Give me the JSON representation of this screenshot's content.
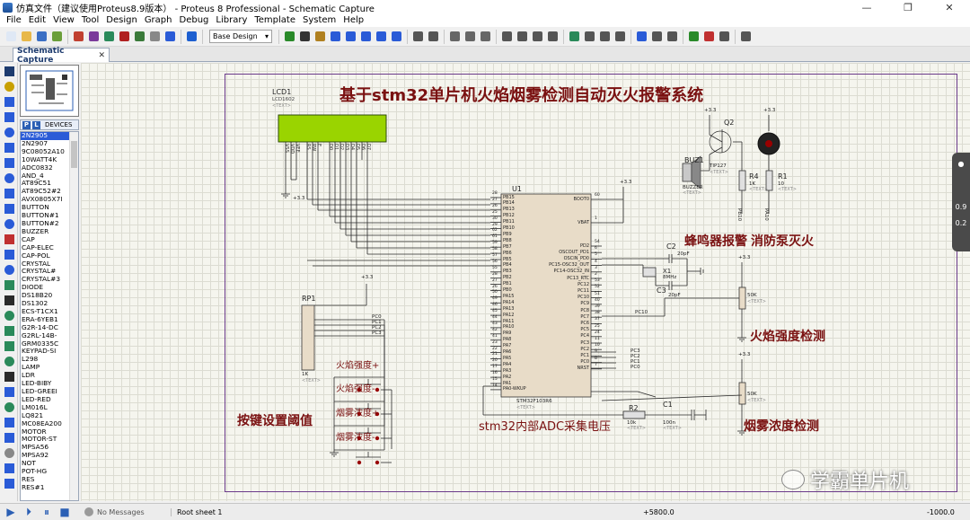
{
  "window": {
    "title": "仿真文件（建议使用Proteus8.9版本） - Proteus 8 Professional - Schematic Capture",
    "minimize": "—",
    "maximize": "❐",
    "close": "✕"
  },
  "menu": [
    "File",
    "Edit",
    "View",
    "Tool",
    "Design",
    "Graph",
    "Debug",
    "Library",
    "Template",
    "System",
    "Help"
  ],
  "toolbar": {
    "design_select": "Base Design"
  },
  "tabs": [
    {
      "label": "Schematic Capture",
      "close": "✕"
    }
  ],
  "devices": {
    "tabs": [
      "P",
      "L"
    ],
    "header": "DEVICES",
    "items": [
      "2N2905",
      "2N2907",
      "9C08052A10",
      "10WATT4K",
      "ADC0832",
      "AND_4",
      "AT89C51",
      "AT89C52#2",
      "AVX0805X7I",
      "BUTTON",
      "BUTTON#1",
      "BUTTON#2",
      "BUZZER",
      "CAP",
      "CAP-ELEC",
      "CAP-POL",
      "CRYSTAL",
      "CRYSTAL#",
      "CRYSTAL#3",
      "DIODE",
      "DS18B20",
      "DS1302",
      "ECS-T1CX1",
      "ERA-6YEB1",
      "G2R-14-DC",
      "G2RL-14B-",
      "GRM0335C",
      "KEYPAD-SI",
      "L298",
      "LAMP",
      "LDR",
      "LED-BIBY",
      "LED-GREEI",
      "LED-RED",
      "LM016L",
      "LQ821",
      "MC08EA200",
      "MOTOR",
      "MOTOR-ST",
      "MPSA56",
      "MPSA92",
      "NOT",
      "POT-HG",
      "RES",
      "RES#1"
    ],
    "selected_index": 0
  },
  "schematic": {
    "title": "基于stm32单片机火焰烟雾检测自动灭火报警系统",
    "labels": {
      "buzzer_alarm": "蜂鸣器报警",
      "pump": "消防泵灭火",
      "flame": "火焰强度检测",
      "smoke": "烟雾浓度检测",
      "keys": "按键设置阈值",
      "adc": "stm32内部ADC采集电压",
      "flame_up": "火焰强度+",
      "flame_dn": "火焰强度-",
      "smoke_up": "烟雾浓度+",
      "smoke_dn": "烟雾浓度-"
    },
    "lcd": {
      "ref": "LCD1",
      "part": "LCD1602",
      "text": "<TEXT>",
      "pins": [
        "VSS",
        "VDD",
        "VEE",
        "RS",
        "RW",
        "E",
        "D0",
        "D1",
        "D2",
        "D3",
        "D4",
        "D5",
        "D6",
        "D7"
      ]
    },
    "mcu": {
      "ref": "U1",
      "part": "STM32F103R6",
      "text": "<TEXT>",
      "left_pins": [
        "PB15",
        "PB14",
        "PB13",
        "PB12",
        "PB11",
        "PB10",
        "PB9",
        "PB8",
        "PB7",
        "PB6",
        "PB5",
        "PB4",
        "PB3",
        "PB2",
        "PB1",
        "PB0",
        "PA15",
        "PA14",
        "PA13",
        "PA12",
        "PA11",
        "PA10",
        "PA9",
        "PA8",
        "PA7",
        "PA6",
        "PA5",
        "PA4",
        "PA3",
        "PA2",
        "PA1",
        "PA0-WKUP"
      ],
      "left_nums": [
        "28",
        "27",
        "26",
        "25",
        "30",
        "29",
        "62",
        "61",
        "59",
        "58",
        "57",
        "56",
        "55",
        "28",
        "27",
        "26",
        "50",
        "49",
        "46",
        "45",
        "44",
        "43",
        "42",
        "41",
        "23",
        "22",
        "21",
        "20",
        "17",
        "16",
        "15",
        "14"
      ],
      "right_pins": [
        "BOOT0",
        "VBAT",
        "PD2",
        "OSCOUT_PD1",
        "OSCIN_PD0",
        "PC15-OSC32_OUT",
        "PC14-OSC32_IN",
        "PC13_RTC",
        "PC12",
        "PC11",
        "PC10",
        "PC9",
        "PC8",
        "PC7",
        "PC6",
        "PC5",
        "PC4",
        "PC3",
        "PC2",
        "PC1",
        "PC0",
        "NRST"
      ],
      "right_nums": [
        "60",
        "1",
        "54",
        "6",
        "5",
        "4",
        "3",
        "2",
        "53",
        "52",
        "51",
        "40",
        "39",
        "38",
        "37",
        "25",
        "24",
        "11",
        "10",
        "9",
        "8",
        "7"
      ]
    },
    "q2": {
      "ref": "Q2",
      "part": "TIP127",
      "text": "<TEXT>"
    },
    "buzzer": {
      "ref": "BUZ1",
      "part": "BUZZER",
      "text": "<TEXT>"
    },
    "r4": {
      "ref": "R4",
      "value": "1K",
      "text": "<TEXT>"
    },
    "r1": {
      "ref": "R1",
      "value": "10",
      "text": "<TEXT>"
    },
    "r2": {
      "ref": "R2",
      "value": "10k",
      "text": "<TEXT>"
    },
    "rp1": {
      "ref": "RP1",
      "value": "1K",
      "text": "<TEXT>"
    },
    "c1": {
      "ref": "C1",
      "value": "100n",
      "text": "<TEXT>"
    },
    "c2": {
      "ref": "C2",
      "value": "20pF",
      "text": "<TEXT>"
    },
    "c3": {
      "ref": "C3",
      "value": "20pF",
      "text": "<TEXT>"
    },
    "x1": {
      "ref": "X1",
      "value": "8MHz",
      "text": "<TEXT>"
    },
    "pot1": {
      "value": "50K",
      "text": "<TEXT>"
    },
    "pot2": {
      "value": "50K",
      "text": "<TEXT>"
    },
    "nets": {
      "v33": "+3.3",
      "pc0": "PC0",
      "pc1": "PC1",
      "pc2": "PC2",
      "pc3": "PC3",
      "pc10": "PC10",
      "pb10": "PB10",
      "pa10": "PA10"
    }
  },
  "right_panel": {
    "upper": "0.9",
    "lower": "0.2"
  },
  "watermark": "学霸单片机",
  "status": {
    "messages": "No Messages",
    "sheet": "Root sheet 1",
    "x": "+5800.0",
    "y": "-1000.0"
  },
  "colors": {
    "accent": "#2a5bd7",
    "frame": "#6b3a8a",
    "title_red": "#7a1111",
    "lcd_green": "#9ad400",
    "wire": "#2a2a2a"
  }
}
